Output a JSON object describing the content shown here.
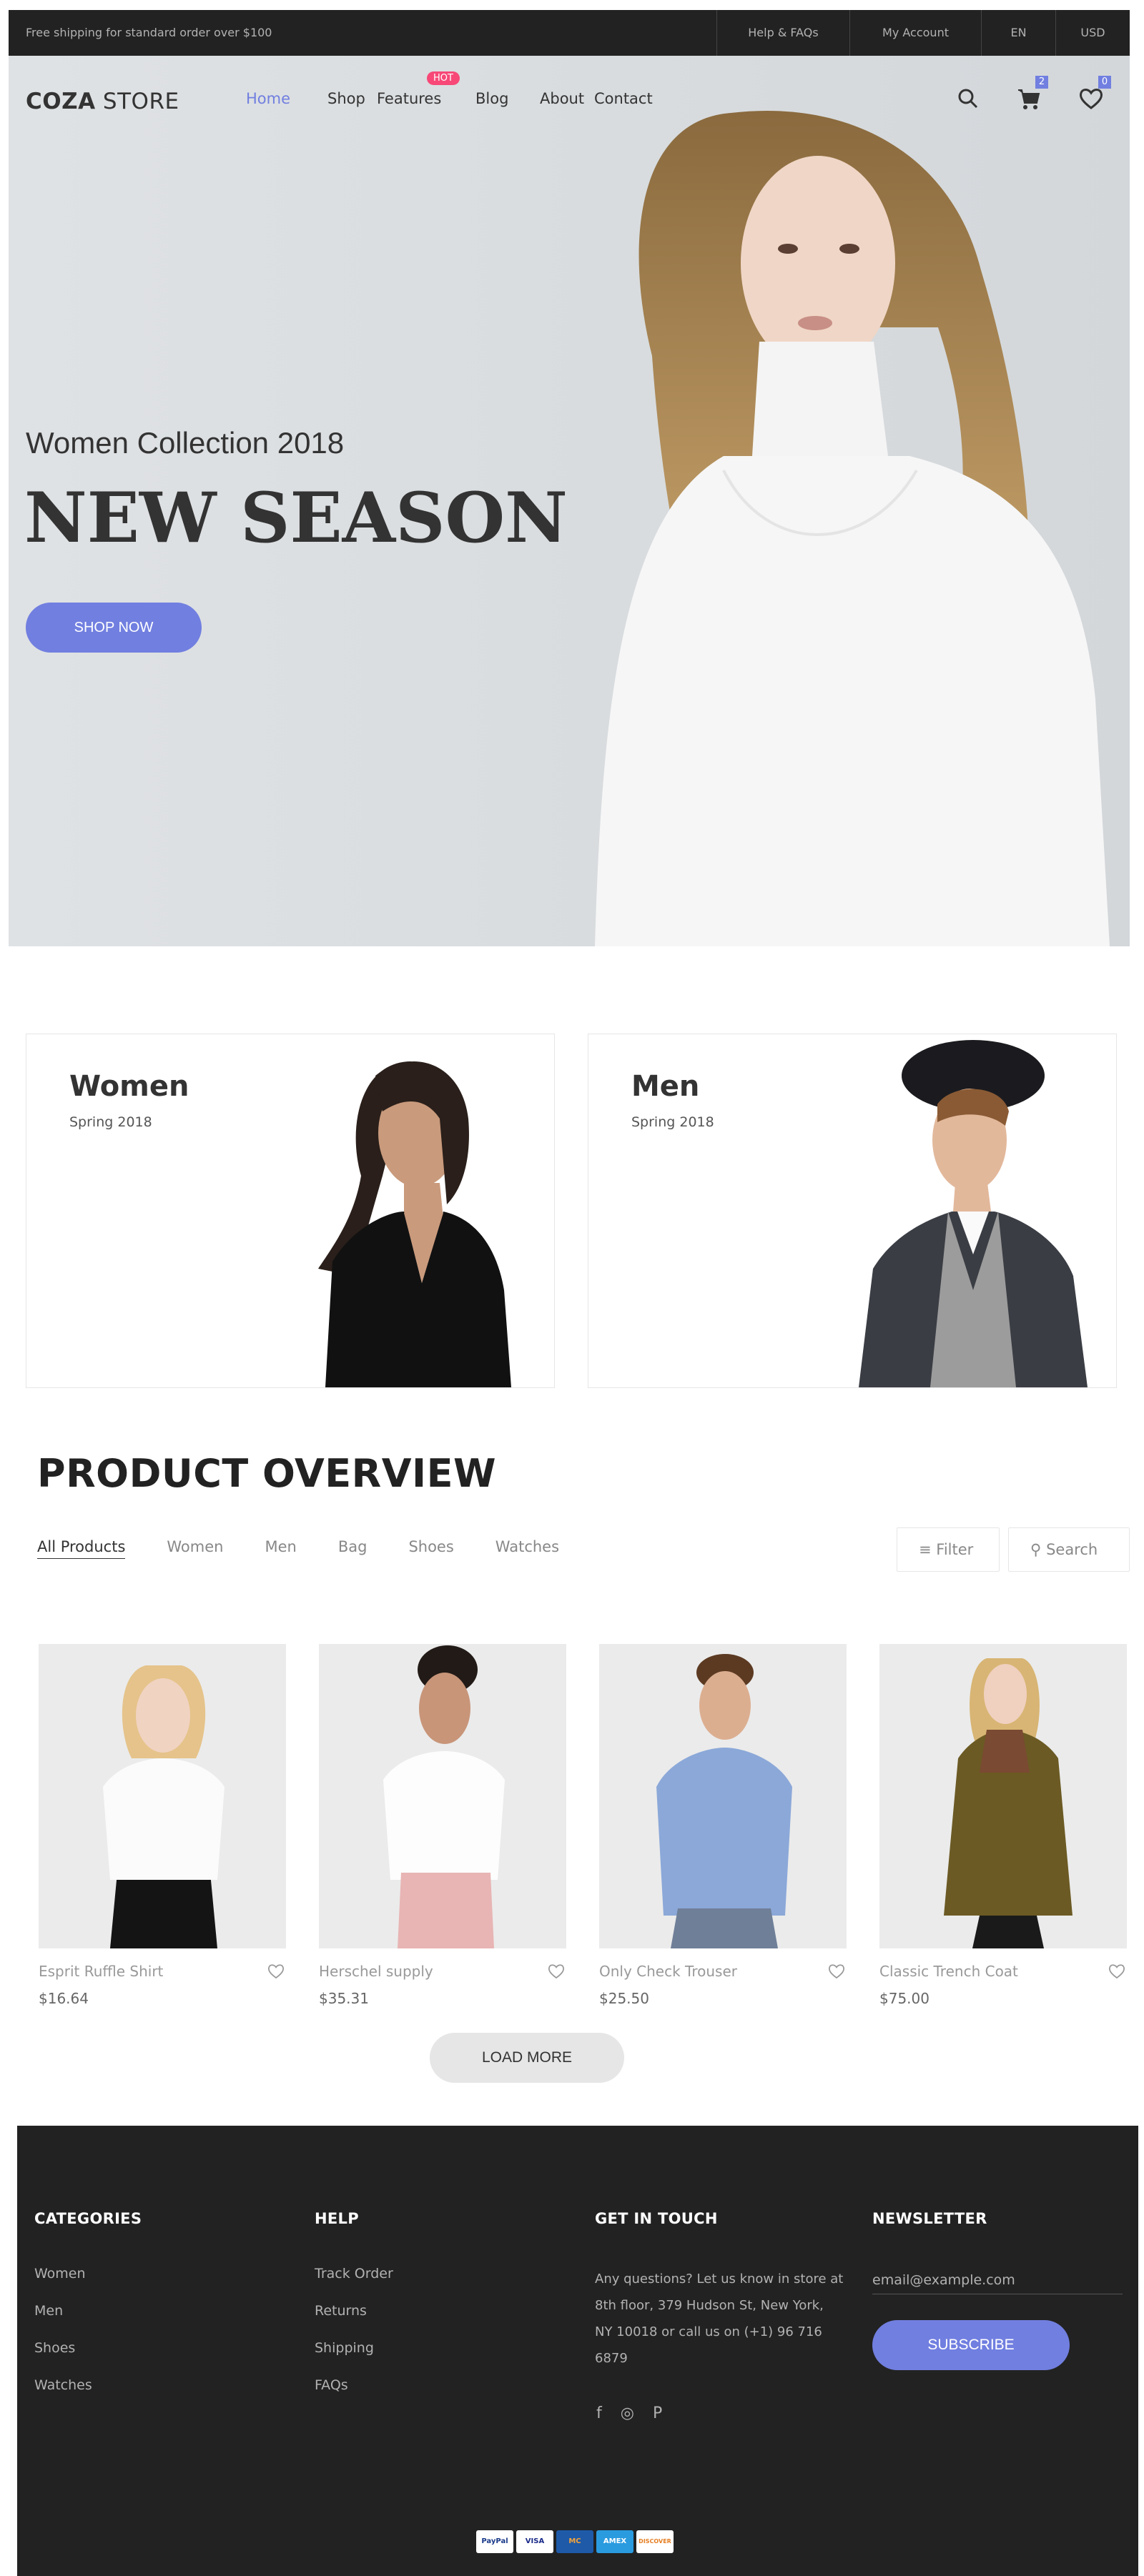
{
  "topbar": {
    "shipping_text": "Free shipping for standard order over $100",
    "links": [
      "Help & FAQs",
      "My Account",
      "EN",
      "USD"
    ]
  },
  "header": {
    "logo_bold": "COZA",
    "logo_light": " STORE",
    "nav": [
      "Home",
      "Shop",
      "Features",
      "Blog",
      "About",
      "Contact"
    ],
    "active_nav": "Home",
    "features_badge": "HOT",
    "cart_count": "2",
    "wishlist_count": "0",
    "icons": [
      "search-icon",
      "cart-icon",
      "heart-icon"
    ]
  },
  "hero": {
    "subtitle": "Women Collection 2018",
    "title": "NEW SEASON",
    "cta": "SHOP NOW"
  },
  "banners": [
    {
      "title": "Women",
      "subtitle": "Spring 2018"
    },
    {
      "title": "Men",
      "subtitle": "Spring 2018"
    }
  ],
  "overview": {
    "title": "PRODUCT OVERVIEW",
    "filters": [
      "All Products",
      "Women",
      "Men",
      "Bag",
      "Shoes",
      "Watches"
    ],
    "active_filter": "All Products",
    "filter_label": "Filter",
    "search_label": "Search",
    "products": [
      {
        "name": "Esprit Ruffle Shirt",
        "price": "$16.64"
      },
      {
        "name": "Herschel supply",
        "price": "$35.31"
      },
      {
        "name": "Only Check Trouser",
        "price": "$25.50"
      },
      {
        "name": "Classic Trench Coat",
        "price": "$75.00"
      }
    ],
    "load_more": "LOAD MORE"
  },
  "footer": {
    "categories": {
      "title": "CATEGORIES",
      "items": [
        "Women",
        "Men",
        "Shoes",
        "Watches"
      ]
    },
    "help": {
      "title": "HELP",
      "items": [
        "Track Order",
        "Returns",
        "Shipping",
        "FAQs"
      ]
    },
    "contact": {
      "title": "GET IN TOUCH",
      "text": "Any questions? Let us know in store at 8th floor, 379 Hudson St, New York, NY 10018 or call us on (+1) 96 716 6879"
    },
    "social": [
      "f",
      "◎",
      "P"
    ],
    "newsletter": {
      "title": "NEWSLETTER",
      "placeholder": "email@example.com",
      "button": "SUBSCRIBE"
    },
    "payments": [
      "PayPal",
      "VISA",
      "MC",
      "AMEX",
      "DISCOVER"
    ]
  },
  "colors": {
    "accent": "#717fe0",
    "hot": "#f74877",
    "dark": "#222222",
    "hero_bg": "#dde0e2"
  }
}
